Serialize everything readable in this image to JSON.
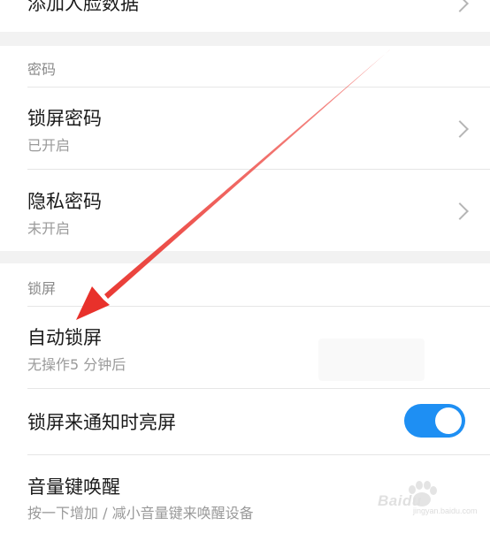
{
  "top_item": {
    "title": "添加人脸数据"
  },
  "password_section": {
    "header": "密码",
    "items": [
      {
        "title": "锁屏密码",
        "subtitle": "已开启"
      },
      {
        "title": "隐私密码",
        "subtitle": "未开启"
      }
    ]
  },
  "lock_section": {
    "header": "锁屏",
    "auto_lock": {
      "title": "自动锁屏",
      "subtitle": "无操作5 分钟后"
    },
    "wake_on_notify": {
      "title": "锁屏来通知时亮屏",
      "toggle_on": true
    },
    "volume_wake": {
      "title": "音量键唤醒",
      "subtitle": "按一下增加 / 减小音量键来唤醒设备"
    }
  },
  "annotation": {
    "arrow_color": "#e8312b"
  },
  "watermark": {
    "text": "Baidu",
    "url": "jingyan.baidu.com"
  },
  "colors": {
    "toggle_on": "#1e8ff3",
    "section_bg": "#f2f2f2"
  }
}
